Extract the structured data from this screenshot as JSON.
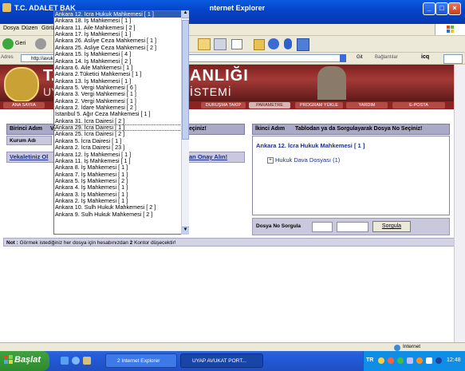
{
  "window": {
    "title_left": "T.C. ADALET BAK",
    "title_right": "nternet Explorer"
  },
  "menu": [
    "Dosya",
    "Düzen",
    "Görü"
  ],
  "toolbar": {
    "back_label": "Geri"
  },
  "address": {
    "label": "Adres",
    "url": "http://avukat",
    "go_label": "Git",
    "links_label": "Bağlantılar",
    "icq_label": "icq"
  },
  "banner": {
    "title_part1": "T.",
    "title_part2": "ANLIĞI",
    "subtitle_part1": "UY",
    "subtitle_part2": "İSTEMİ"
  },
  "nav": [
    "ANA SAYFA",
    "DURUŞMA TAKİP",
    "PARAMETRE",
    "PROGRAM YÜKLE",
    "YARDIM",
    "E-POSTA"
  ],
  "left_panel": {
    "header_a": "Birinci Adım",
    "header_b": "V",
    "header_c": "eçiniz!",
    "row_label": "Kurum Adı",
    "link_a": "Vekaletiniz Ol",
    "link_b": "an Onay Alın!"
  },
  "right_panel": {
    "step_label": "İkinci Adım",
    "instruction": "Tablodan ya da Sorgulayarak Dosya No Seçiniz!",
    "court_title": "Ankara 12. İcra Hukuk Mahkemesi [ 1 ]",
    "tree_item": "Hukuk Dava Dosyası (1)",
    "query_label": "Dosya No Sorgula",
    "query_button": "Sorgula"
  },
  "note": {
    "prefix": "Not :",
    "text_before": " Görmek istediğiniz her dosya için hesabınızdan ",
    "amount": "2",
    "text_after": " Kontor düşecektir!"
  },
  "dropdown": {
    "options": [
      "Ankara 12. İcra Hukuk Mahkemesi [ 1 ]",
      "Ankara 18. İş Mahkemesi [ 1 ]",
      "Ankara 11. Aile Mahkemesi [ 2 ]",
      "Ankara 17. İş Mahkemesi [ 1 ]",
      "Ankara 26. Asliye Ceza Mahkemesi [ 1 ]",
      "Ankara 25. Asliye Ceza Mahkemesi [ 2 ]",
      "Ankara 15. İş Mahkemesi [ 4 ]",
      "Ankara 14. İş Mahkemesi [ 2 ]",
      "Ankara 6. Aile Mahkemesi [ 1 ]",
      "Ankara 2.Tüketici Mahkemesi [ 1 ]",
      "Ankara 13. İş Mahkemesi [ 1 ]",
      "Ankara 5. Vergi Mahkemesi [ 6 ]",
      "Ankara 3. Vergi Mahkemesi [ 1 ]",
      "Ankara 2. Vergi Mahkemesi [ 1 ]",
      "Ankara 2. İdare Mahkemesi [ 2 ]",
      "İstanbul 5. Ağır Ceza Mahkemesi [ 1 ]",
      "Ankara 31. İcra Dairesi [ 2 ]",
      "Ankara 29. İcra Dairesi [ 1 ]",
      "Ankara 25. İcra Dairesi [ 2 ]",
      "Ankara 5. İcra Dairesi [ 1 ]",
      "Ankara 2. İcra Dairesi [ 23 ]",
      "Ankara 12. İş Mahkemesi [ 1 ]",
      "Ankara 11. İş Mahkemesi [ 1 ]",
      "Ankara 8. İş Mahkemesi [ 1 ]",
      "Ankara 7. İş Mahkemesi [ 1 ]",
      "Ankara 5. İş Mahkemesi [ 2 ]",
      "Ankara 4. İş Mahkemesi [ 1 ]",
      "Ankara 3. İş Mahkemesi [ 1 ]",
      "Ankara 2. İş Mahkemesi [ 1 ]",
      "Ankara 10. Sulh Hukuk Mahkemesi [ 2 ]",
      "Ankara 9. Sulh Hukuk Mahkemesi [ 2 ]"
    ]
  },
  "status": {
    "zone": "Internet"
  },
  "taskbar": {
    "start": "Başlat",
    "items": [
      "2 Internet Explorer",
      "UYAP AVUKAT PORT..."
    ],
    "lang": "TR",
    "clock": "12:48"
  },
  "colors": {
    "title_bar": "#0343c9",
    "banner": "#a53a35",
    "panel_header": "#aaa9c6",
    "selected_option": "#2d5db5",
    "link": "#1b2f8f",
    "taskbar": "#245ddb",
    "start_button": "#3ea33e"
  }
}
